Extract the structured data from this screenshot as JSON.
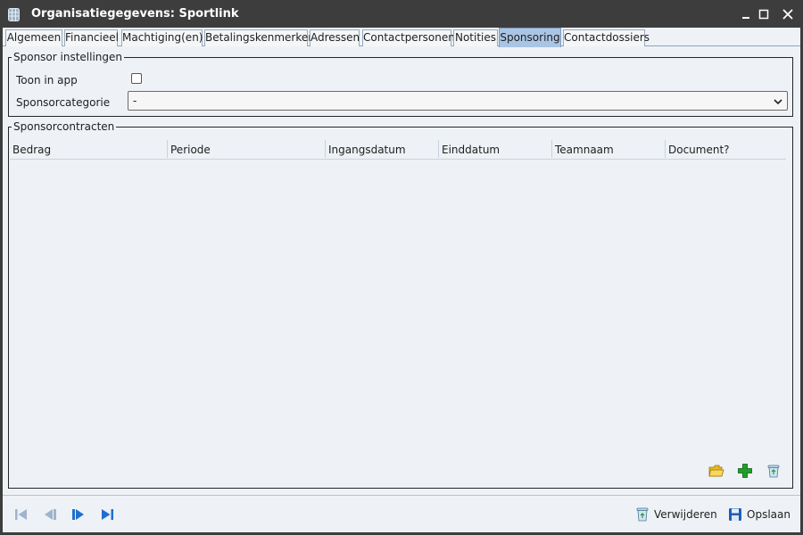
{
  "window": {
    "title": "Organisatiegegevens: Sportlink"
  },
  "tabs": [
    {
      "label": "Algemeen",
      "active": false
    },
    {
      "label": "Financieel",
      "active": false
    },
    {
      "label": "Machtiging(en)",
      "active": false
    },
    {
      "label": "Betalingskenmerken",
      "active": false
    },
    {
      "label": "Adressen",
      "active": false
    },
    {
      "label": "Contactpersonen",
      "active": false
    },
    {
      "label": "Notities",
      "active": false
    },
    {
      "label": "Sponsoring",
      "active": true
    },
    {
      "label": "Contactdossiers",
      "active": false
    }
  ],
  "settings": {
    "legend": "Sponsor instellingen",
    "show_in_app_label": "Toon in app",
    "show_in_app_checked": false,
    "category_label": "Sponsorcategorie",
    "category_value": "-"
  },
  "contracts": {
    "legend": "Sponsorcontracten",
    "columns": [
      "Bedrag",
      "Periode",
      "Ingangsdatum",
      "Einddatum",
      "Teamnaam",
      "Document?"
    ],
    "rows": []
  },
  "grid_buttons": {
    "open_icon": "folder-icon",
    "add_icon": "plus-icon",
    "delete_icon": "recycle-bin-icon"
  },
  "footer": {
    "delete_label": "Verwijderen",
    "save_label": "Opslaan"
  },
  "colors": {
    "active_tab": "#a9c5e3",
    "panel_background": "#eef2f6",
    "nav_blue": "#1f6fd1",
    "add_green": "#1f9e2a"
  }
}
